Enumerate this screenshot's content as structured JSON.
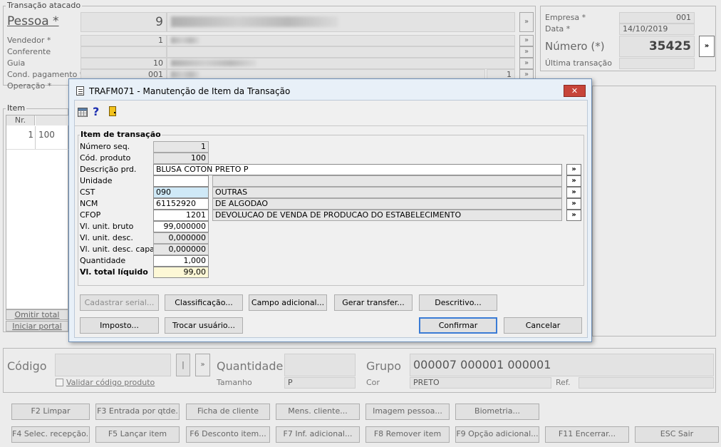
{
  "main": {
    "group_title": "Transação atacado",
    "pessoa_label": "Pessoa *",
    "pessoa_code": "9",
    "vendedor_label": "Vendedor *",
    "vendedor_code": "1",
    "conferente_label": "Conferente",
    "guia_label": "Guia",
    "guia_code": "10",
    "cond_label": "Cond. pagamento *",
    "cond_code": "001",
    "cond_parcelas": "1",
    "operacao_label": "Operação *",
    "empresa_label": "Empresa *",
    "empresa_value": "001",
    "data_label": "Data *",
    "data_value": "14/10/2019",
    "numero_label": "Número (*)",
    "numero_value": "35425",
    "ultima_label": "Última transação",
    "arrow_glyph": "»"
  },
  "item_panel": {
    "title": "Item",
    "col_nr": "Nr.",
    "row_nr": "1",
    "row_code": "100",
    "omitir_label": "Omitir total",
    "iniciar_label": "Iniciar portal"
  },
  "bottom": {
    "codigo_label": "Código",
    "codigo_sep": "|",
    "validar_label": "Validar código produto",
    "quantidade_label": "Quantidade",
    "tamanho_label": "Tamanho",
    "tamanho_value": "P",
    "grupo_label": "Grupo",
    "grupo_value": "000007 000001 000001",
    "cor_label": "Cor",
    "cor_value": "PRETO",
    "ref_label": "Ref."
  },
  "fkeys_row1": [
    "F2 Limpar",
    "F3 Entrada por qtde.",
    "Ficha de cliente",
    "Mens. cliente...",
    "Imagem pessoa...",
    "Biometria..."
  ],
  "fkeys_row2": [
    "F4 Selec. recepção..",
    "F5 Lançar item",
    "F6 Desconto item...",
    "F7 Inf. adicional...",
    "F8 Remover item",
    "F9 Opção adicional...",
    "F11 Encerrar...",
    "ESC Sair"
  ],
  "dialog": {
    "title": "TRAFM071 - Manutenção de Item da Transação",
    "close_glyph": "✕",
    "section_title": "Item de transação",
    "numero_seq_label": "Número seq.",
    "numero_seq": "1",
    "cod_produto_label": "Cód. produto",
    "cod_produto": "100",
    "descricao_label": "Descrição prd.",
    "descricao": "BLUSA COTON PRETO P",
    "unidade_label": "Unidade",
    "unidade": "",
    "cst_label": "CST",
    "cst": "090",
    "cst_desc": "OUTRAS",
    "ncm_label": "NCM",
    "ncm": "61152920",
    "ncm_desc": "DE ALGODAO",
    "cfop_label": "CFOP",
    "cfop": "1201",
    "cfop_desc": "DEVOLUCAO DE VENDA DE PRODUCAO DO ESTABELECIMENTO",
    "vl_bruto_label": "Vl. unit. bruto",
    "vl_bruto": "99,000000",
    "vl_desc_label": "Vl. unit. desc.",
    "vl_desc": "0,000000",
    "vl_desc_capa_label": "Vl. unit. desc. capa",
    "vl_desc_capa": "0,000000",
    "quantidade_label": "Quantidade",
    "quantidade": "1,000",
    "vl_total_label": "Vl. total líquido",
    "vl_total": "99,00",
    "arrow_glyph": "»",
    "btn_cadastrar_serial": "Cadastrar serial...",
    "btn_classificacao": "Classificação...",
    "btn_campo_adicional": "Campo adicional...",
    "btn_gerar_transfer": "Gerar transfer...",
    "btn_descritivo": "Descritivo...",
    "btn_imposto": "Imposto...",
    "btn_trocar_usuario": "Trocar usuário...",
    "btn_confirmar": "Confirmar",
    "btn_cancelar": "Cancelar"
  }
}
